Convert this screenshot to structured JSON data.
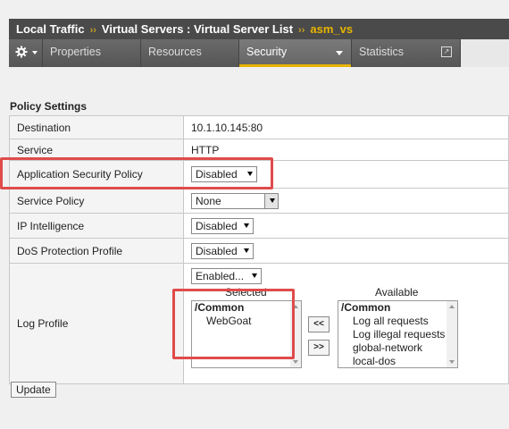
{
  "breadcrumb": {
    "items": [
      "Local Traffic",
      "Virtual Servers : Virtual Server List"
    ],
    "current": "asm_vs",
    "separator": "››"
  },
  "tabs": {
    "gear_icon": "gear-icon",
    "items": [
      {
        "label": "Properties"
      },
      {
        "label": "Resources"
      },
      {
        "label": "Security"
      },
      {
        "label": "Statistics"
      }
    ],
    "active": "Security"
  },
  "section_title": "Policy Settings",
  "rows": {
    "destination": {
      "label": "Destination",
      "value": "10.1.10.145:80"
    },
    "service": {
      "label": "Service",
      "value": "HTTP"
    },
    "app_security_policy": {
      "label": "Application Security Policy",
      "value": "Disabled"
    },
    "service_policy": {
      "label": "Service Policy",
      "value": "None"
    },
    "ip_intelligence": {
      "label": "IP Intelligence",
      "value": "Disabled"
    },
    "dos_profile": {
      "label": "DoS Protection Profile",
      "value": "Disabled"
    },
    "log_profile": {
      "label": "Log Profile",
      "select_value": "Enabled...",
      "selected_header": "Selected",
      "available_header": "Available",
      "selected_group": "/Common",
      "selected_items": [
        "WebGoat"
      ],
      "available_group": "/Common",
      "available_items": [
        "Log all requests",
        "Log illegal requests",
        "global-network",
        "local-dos"
      ],
      "move_left": "<<",
      "move_right": ">>"
    }
  },
  "update_button": "Update",
  "colors": {
    "header_bg": "#4a4a4a",
    "accent": "#e8b400",
    "highlight": "#e04b4b"
  }
}
